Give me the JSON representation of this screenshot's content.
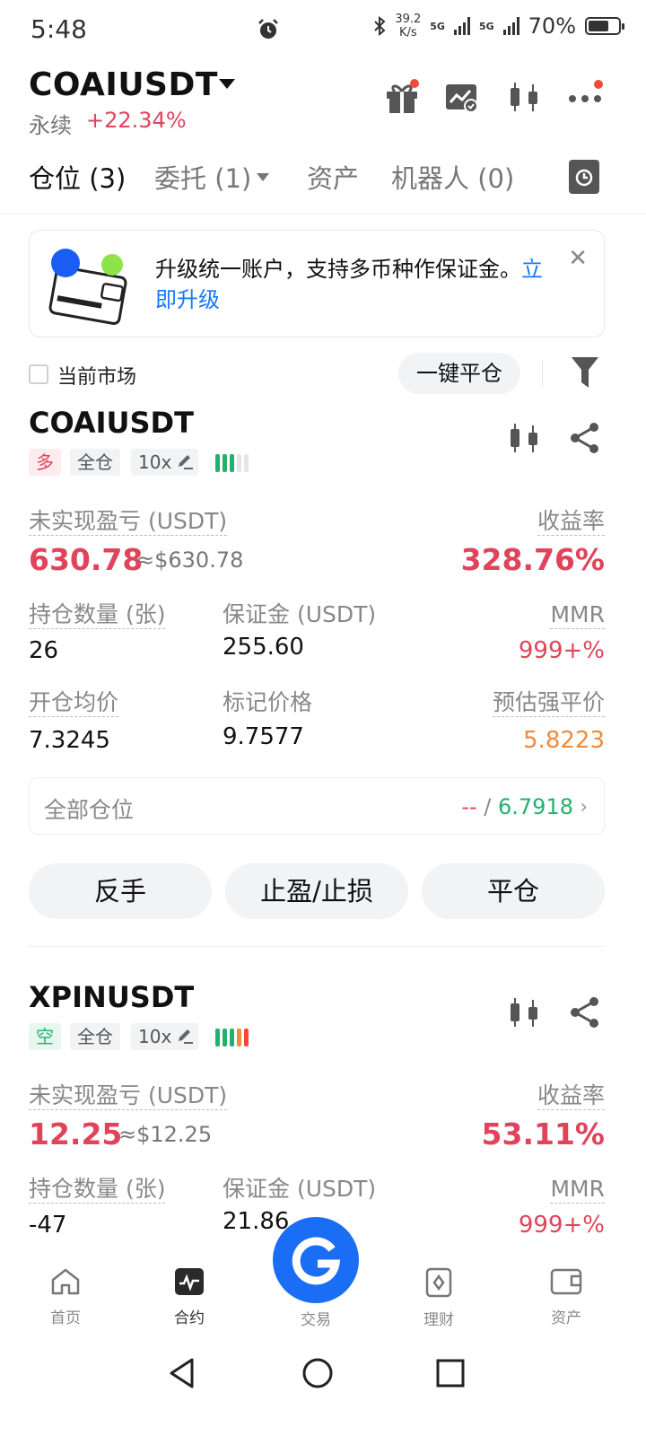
{
  "status_bar": {
    "time": "5:48",
    "speed_value": "39.2",
    "speed_unit": "K/s",
    "network_1": "5G",
    "network_2": "5G",
    "battery_pct": "70%",
    "battery_level": 0.7
  },
  "header": {
    "pair": "COAIUSDT",
    "contract_type": "永续",
    "change": "+22.34%",
    "icons": [
      "gift-icon",
      "chart-check-icon",
      "candlestick-icon",
      "more-icon"
    ]
  },
  "tabs": [
    {
      "label": "仓位 (3)"
    },
    {
      "label": "委托 (1)"
    },
    {
      "label": "资产"
    },
    {
      "label": "机器人 (0)"
    }
  ],
  "banner": {
    "text": "升级统一账户，支持多币种作保证金。",
    "link": "立即升级",
    "close": "✕"
  },
  "filter": {
    "current_market_label": "当前市场",
    "close_all_label": "一键平仓"
  },
  "positions": [
    {
      "symbol": "COAIUSDT",
      "side": "多",
      "margin_mode": "全仓",
      "leverage": "10x",
      "pnl_label": "未实现盈亏 (USDT)",
      "pnl": "630.78",
      "pnl_approx": "≈$630.78",
      "roe_label": "收益率",
      "roe": "328.76%",
      "qty_label": "持仓数量 (张)",
      "qty": "26",
      "margin_label": "保证金 (USDT)",
      "margin": "255.60",
      "mmr_label": "MMR",
      "mmr": "999+%",
      "entry_label": "开仓均价",
      "entry": "7.3245",
      "mark_label": "标记价格",
      "mark": "9.7577",
      "liq_label": "预估强平价",
      "liq": "5.8223",
      "risk_colors": [
        "#20b26c",
        "#20b26c",
        "#20b26c",
        "#e5e5e5",
        "#e5e5e5"
      ]
    },
    {
      "symbol": "XPINUSDT",
      "side": "空",
      "margin_mode": "全仓",
      "leverage": "10x",
      "pnl_label": "未实现盈亏 (USDT)",
      "pnl": "12.25",
      "pnl_approx": "≈$12.25",
      "roe_label": "收益率",
      "roe": "53.11%",
      "qty_label": "持仓数量 (张)",
      "qty": "-47",
      "margin_label": "保证金 (USDT)",
      "margin": "21.86",
      "mmr_label": "MMR",
      "mmr": "999+%",
      "risk_colors": [
        "#20b26c",
        "#20b26c",
        "#20b26c",
        "#f08a3c",
        "#f04a3a"
      ]
    }
  ],
  "summary": {
    "label": "全部仓位",
    "dash": "--",
    "slash": "/",
    "value": "6.7918"
  },
  "actions": {
    "reverse": "反手",
    "tpsl": "止盈/止损",
    "close": "平仓"
  },
  "bottom_nav": [
    {
      "label": "首页"
    },
    {
      "label": "合约"
    },
    {
      "label": "交易"
    },
    {
      "label": "理财"
    },
    {
      "label": "资产"
    }
  ],
  "colors": {
    "up": "#e0445b",
    "down": "#20b26c",
    "accent": "#1677ff",
    "trade_button": "#1a6df5",
    "warning": "#f08a3c"
  }
}
